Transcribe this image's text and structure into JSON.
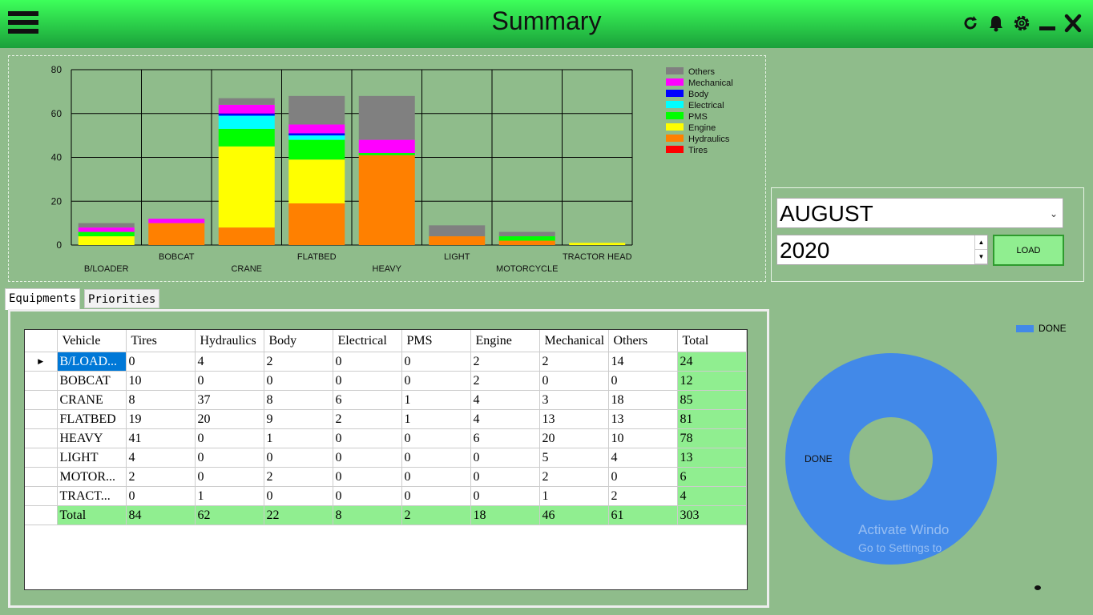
{
  "header": {
    "title": "Summary"
  },
  "filter": {
    "month": "AUGUST",
    "year": "2020",
    "load_label": "LOAD"
  },
  "tabs": [
    {
      "label": "Equipments"
    },
    {
      "label": "Priorities"
    }
  ],
  "table": {
    "columns": [
      "Vehicle",
      "Tires",
      "Hydraulics",
      "Body",
      "Electrical",
      "PMS",
      "Engine",
      "Mechanical",
      "Others",
      "Total"
    ],
    "rows": [
      [
        "B/LOAD...",
        "0",
        "4",
        "2",
        "0",
        "0",
        "2",
        "2",
        "14",
        "24"
      ],
      [
        "BOBCAT",
        "10",
        "0",
        "0",
        "0",
        "0",
        "2",
        "0",
        "0",
        "12"
      ],
      [
        "CRANE",
        "8",
        "37",
        "8",
        "6",
        "1",
        "4",
        "3",
        "18",
        "85"
      ],
      [
        "FLATBED",
        "19",
        "20",
        "9",
        "2",
        "1",
        "4",
        "13",
        "13",
        "81"
      ],
      [
        "HEAVY",
        "41",
        "0",
        "1",
        "0",
        "0",
        "6",
        "20",
        "10",
        "78"
      ],
      [
        "LIGHT",
        "4",
        "0",
        "0",
        "0",
        "0",
        "0",
        "5",
        "4",
        "13"
      ],
      [
        "MOTOR...",
        "2",
        "0",
        "2",
        "0",
        "0",
        "0",
        "2",
        "0",
        "6"
      ],
      [
        "TRACT...",
        "0",
        "1",
        "0",
        "0",
        "0",
        "0",
        "1",
        "2",
        "4"
      ],
      [
        "Total",
        "84",
        "62",
        "22",
        "8",
        "2",
        "18",
        "46",
        "61",
        "303"
      ]
    ]
  },
  "pie": {
    "legend_label": "DONE",
    "slice_label": "DONE",
    "color": "#4289e8"
  },
  "watermark": {
    "line1": "Activate Windo",
    "line2": "Go to Settings to"
  },
  "chart_data": {
    "type": "bar",
    "stacked": true,
    "categories": [
      "B/LOADER",
      "BOBCAT",
      "CRANE",
      "FLATBED",
      "HEAVY",
      "LIGHT",
      "MOTORCYCLE",
      "TRACTOR HEAD"
    ],
    "ylim": [
      0,
      80
    ],
    "yticks": [
      0,
      20,
      40,
      60,
      80
    ],
    "legend_position": "right",
    "series": [
      {
        "name": "Tires",
        "color": "#ff0000",
        "values": [
          0,
          0,
          0,
          0,
          0,
          0,
          0,
          0
        ]
      },
      {
        "name": "Hydraulics",
        "color": "#ff8000",
        "values": [
          0,
          10,
          8,
          19,
          41,
          4,
          2,
          0
        ]
      },
      {
        "name": "Engine",
        "color": "#ffff00",
        "values": [
          4,
          0,
          37,
          20,
          0,
          0,
          0,
          1
        ]
      },
      {
        "name": "PMS",
        "color": "#00ff00",
        "values": [
          2,
          0,
          8,
          9,
          1,
          0,
          2,
          0
        ]
      },
      {
        "name": "Electrical",
        "color": "#00ffff",
        "values": [
          0,
          0,
          6,
          2,
          0,
          0,
          0,
          0
        ]
      },
      {
        "name": "Body",
        "color": "#0000ff",
        "values": [
          0,
          0,
          1,
          1,
          0,
          0,
          0,
          0
        ]
      },
      {
        "name": "Mechanical",
        "color": "#ff00ff",
        "values": [
          2,
          2,
          4,
          4,
          6,
          0,
          0,
          0
        ]
      },
      {
        "name": "Others",
        "color": "#808080",
        "values": [
          2,
          0,
          3,
          13,
          20,
          5,
          2,
          0
        ]
      }
    ]
  }
}
